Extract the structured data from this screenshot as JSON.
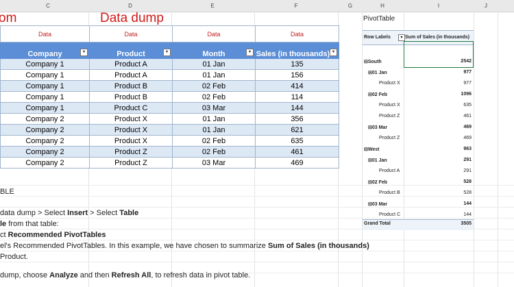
{
  "columns": [
    "C",
    "D",
    "E",
    "F",
    "G",
    "H",
    "I",
    "J"
  ],
  "titles": {
    "left_partial": "om",
    "data_dump": "Data dump"
  },
  "data_labels": [
    "Data",
    "Data",
    "Data",
    "Data"
  ],
  "table": {
    "headers": [
      "Company",
      "Product",
      "Month",
      "Sales (in thousands)"
    ],
    "rows": [
      [
        "Company 1",
        "Product A",
        "01 Jan",
        "135"
      ],
      [
        "Company 1",
        "Product A",
        "01 Jan",
        "156"
      ],
      [
        "Company 1",
        "Product B",
        "02 Feb",
        "414"
      ],
      [
        "Company 1",
        "Product B",
        "02 Feb",
        "114"
      ],
      [
        "Company 1",
        "Product C",
        "03 Mar",
        "144"
      ],
      [
        "Company 2",
        "Product X",
        "01 Jan",
        "356"
      ],
      [
        "Company 2",
        "Product X",
        "01 Jan",
        "621"
      ],
      [
        "Company 2",
        "Product X",
        "02 Feb",
        "635"
      ],
      [
        "Company 2",
        "Product Z",
        "02 Feb",
        "461"
      ],
      [
        "Company 2",
        "Product Z",
        "03 Mar",
        "469"
      ]
    ]
  },
  "instructions": {
    "line0": "BLE",
    "line1_a": "data dump > Select ",
    "line1_b": "Insert",
    "line1_c": " > Select ",
    "line1_d": "Table",
    "line2_a": "le",
    "line2_b": " from that table:",
    "line3_a": "ct ",
    "line3_b": "Recommended PivotTables",
    "line4_a": "el's Recommended PivotTables. In this example, we have chosen to summarize ",
    "line4_b": "Sum of Sales (in thousands)",
    "line5": "Product.",
    "line6_a": "dump, choose ",
    "line6_b": "Analyze",
    "line6_c": " and then ",
    "line6_d": "Refresh All",
    "line6_e": ", to refresh data in pivot table."
  },
  "pivot": {
    "title": "PivotTable",
    "row_labels": "Row Labels",
    "value_header": "Sum of Sales (in thousands)",
    "rows": [
      {
        "label": "⊟South",
        "value": "2542",
        "level": 0
      },
      {
        "label": "⊟01 Jan",
        "value": "977",
        "level": 1
      },
      {
        "label": "Product X",
        "value": "977",
        "level": 2
      },
      {
        "label": "⊟02 Feb",
        "value": "1096",
        "level": 1
      },
      {
        "label": "Product X",
        "value": "635",
        "level": 2
      },
      {
        "label": "Product Z",
        "value": "461",
        "level": 2
      },
      {
        "label": "⊟03 Mar",
        "value": "469",
        "level": 1
      },
      {
        "label": "Product Z",
        "value": "469",
        "level": 2
      },
      {
        "label": "⊟West",
        "value": "963",
        "level": 0
      },
      {
        "label": "⊟01 Jan",
        "value": "291",
        "level": 1
      },
      {
        "label": "Product A",
        "value": "291",
        "level": 2
      },
      {
        "label": "⊟02 Feb",
        "value": "528",
        "level": 1
      },
      {
        "label": "Product B",
        "value": "528",
        "level": 2
      },
      {
        "label": "⊟03 Mar",
        "value": "144",
        "level": 1
      },
      {
        "label": "Product C",
        "value": "144",
        "level": 2
      }
    ],
    "grand_total_label": "Grand Total",
    "grand_total_value": "3505"
  }
}
